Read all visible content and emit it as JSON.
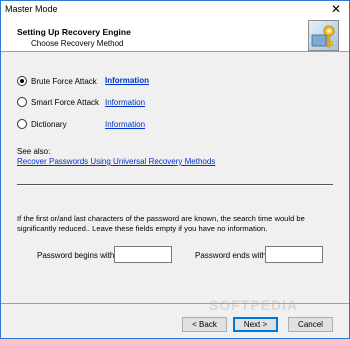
{
  "window": {
    "title": "Master Mode",
    "close_symbol": "✕"
  },
  "header": {
    "title": "Setting Up Recovery Engine",
    "subtitle": "Choose Recovery Method",
    "icon": "wizard-key-icon"
  },
  "methods": [
    {
      "label": "Brute Force Attack",
      "checked": true,
      "link": "Information"
    },
    {
      "label": "Smart Force Attack",
      "checked": false,
      "link": "Information"
    },
    {
      "label": "Dictionary",
      "checked": false,
      "link": "Information"
    }
  ],
  "see_also": {
    "label": "See also:",
    "link": "Recover Passwords Using Universal Recovery Methods"
  },
  "hint": "If the first or/and last characters of the password are known, the search time would be significantly reduced.. Leave these fields empty if you have no information.",
  "fields": {
    "begins_label": "Password begins with",
    "begins_value": "",
    "ends_label": "Password ends with",
    "ends_value": ""
  },
  "buttons": {
    "back": "< Back",
    "next": "Next >",
    "cancel": "Cancel"
  },
  "watermark": "SOFTPEDIA"
}
